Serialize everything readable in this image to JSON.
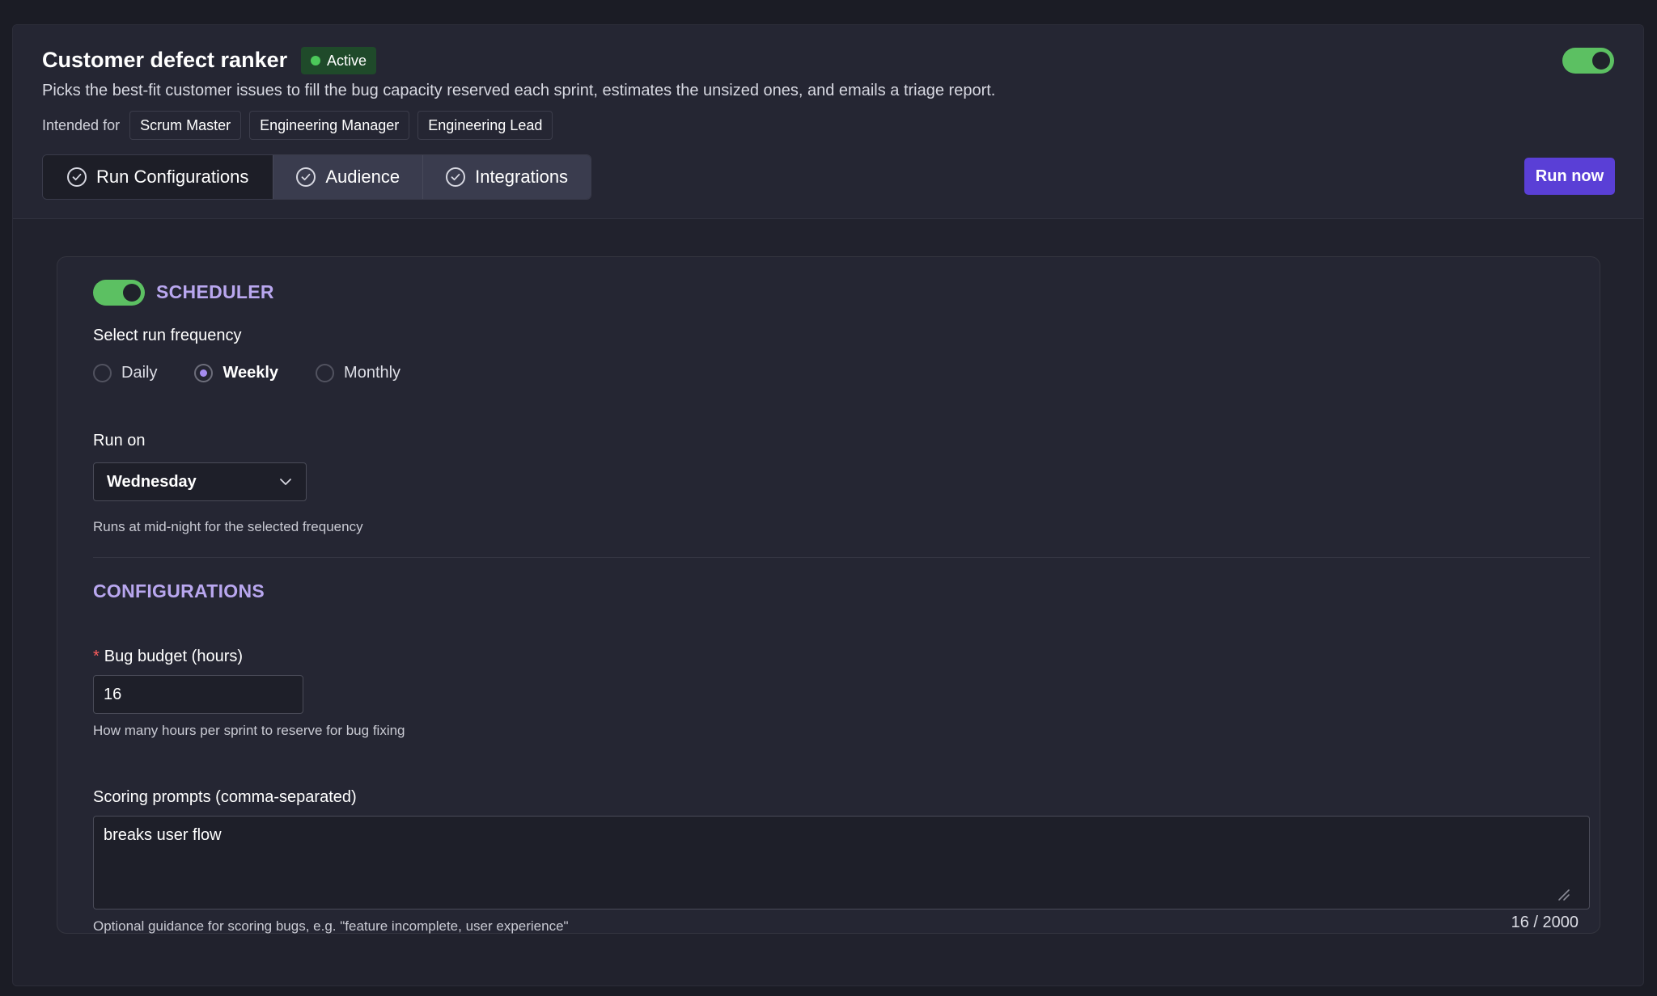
{
  "header": {
    "title": "Customer defect ranker",
    "status": "Active",
    "description": "Picks the best-fit customer issues to fill the bug capacity reserved each sprint, estimates the unsized ones, and emails a triage report.",
    "intended_for_label": "Intended for",
    "audience_chips": [
      "Scrum Master",
      "Engineering Manager",
      "Engineering Lead"
    ],
    "enabled": true
  },
  "tabs": [
    {
      "label": "Run Configurations",
      "active": true
    },
    {
      "label": "Audience",
      "active": false
    },
    {
      "label": "Integrations",
      "active": false
    }
  ],
  "actions": {
    "run_now_label": "Run now"
  },
  "scheduler": {
    "title": "SCHEDULER",
    "enabled": true,
    "frequency_label": "Select run frequency",
    "frequency_options": [
      "Daily",
      "Weekly",
      "Monthly"
    ],
    "selected_frequency": "Weekly",
    "run_on_label": "Run on",
    "run_on_value": "Wednesday",
    "help": "Runs at mid-night for the selected frequency"
  },
  "configurations": {
    "title": "CONFIGURATIONS",
    "bug_budget": {
      "required_marker": "*",
      "label": "Bug budget (hours)",
      "value": "16",
      "help": "How many hours per sprint to reserve for bug fixing"
    },
    "scoring_prompts": {
      "label": "Scoring prompts (comma-separated)",
      "value": "breaks user flow",
      "help": "Optional guidance for scoring bugs, e.g. \"feature incomplete, user experience\"",
      "counter": "16 / 2000"
    }
  },
  "colors": {
    "accent": "#5a3fd6",
    "section_title": "#b9a7ef",
    "toggle_on": "#5cc062",
    "status_dot": "#4cc85a"
  }
}
